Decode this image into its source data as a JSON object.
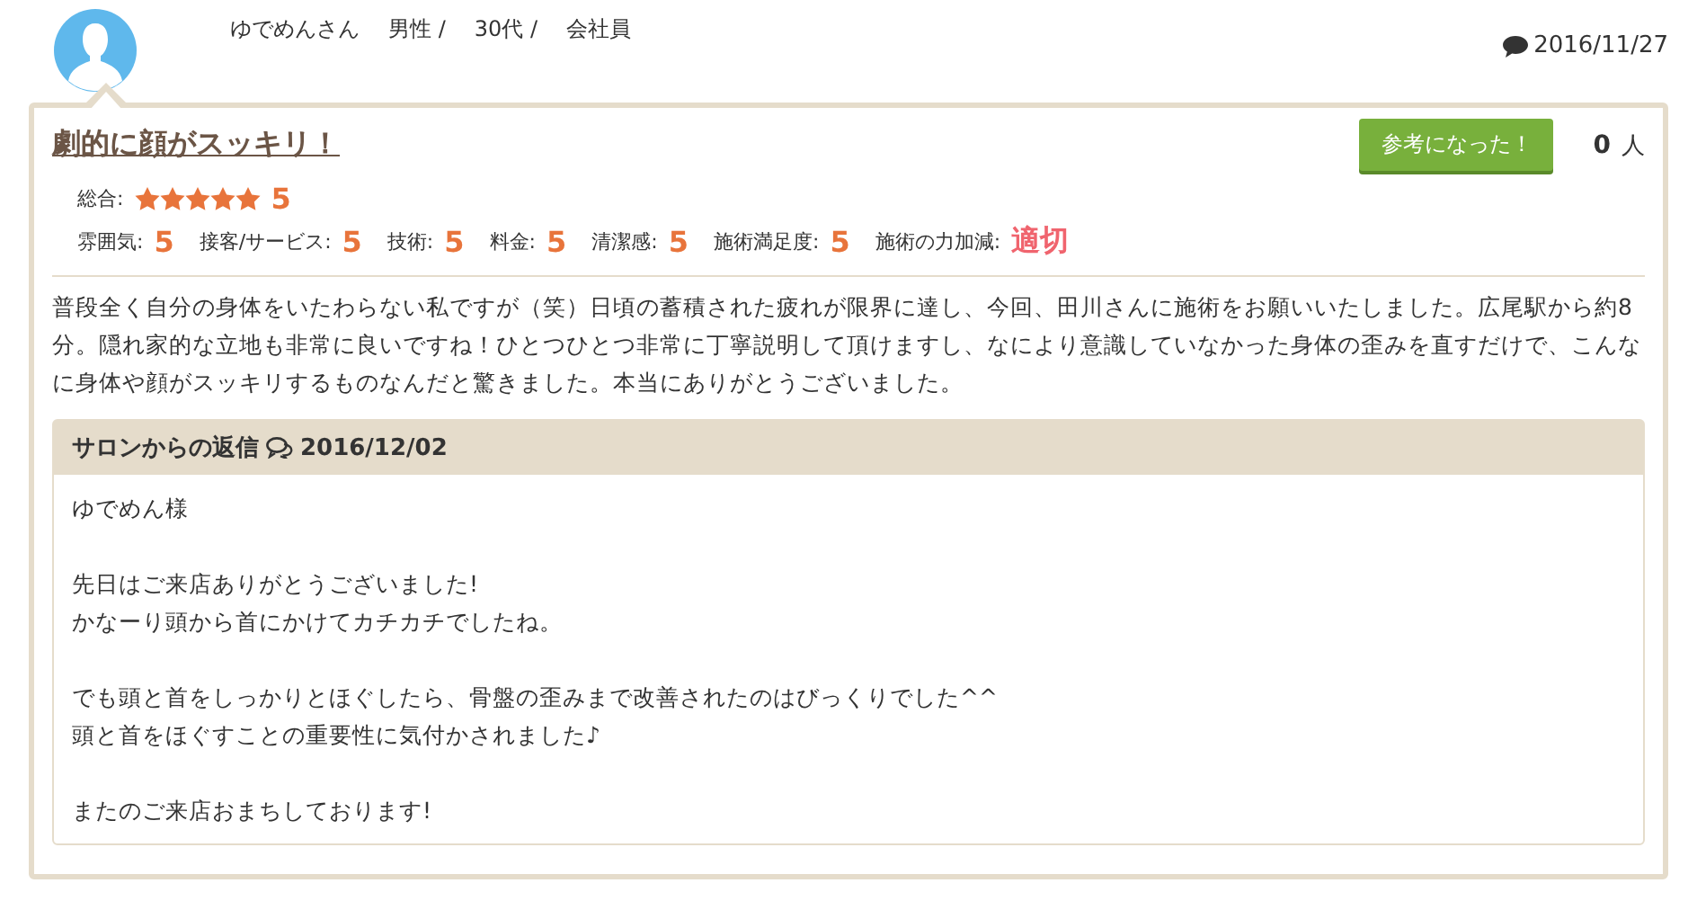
{
  "reviewer": {
    "name": "ゆでめんさん",
    "gender": "男性 /",
    "age": "30代 /",
    "occupation": "会社員"
  },
  "posted_date": "2016/11/27",
  "review": {
    "title": "劇的に顔がスッキリ！",
    "helpful_button": "参考になった！",
    "helpful_count": "0",
    "helpful_unit": "人",
    "overall": {
      "label": "総合:",
      "stars": 5,
      "score": "5"
    },
    "ratings": [
      {
        "label": "雰囲気:",
        "value": "5",
        "kind": "score"
      },
      {
        "label": "接客/サービス:",
        "value": "5",
        "kind": "score"
      },
      {
        "label": "技術:",
        "value": "5",
        "kind": "score"
      },
      {
        "label": "料金:",
        "value": "5",
        "kind": "score"
      },
      {
        "label": "清潔感:",
        "value": "5",
        "kind": "score"
      },
      {
        "label": "施術満足度:",
        "value": "5",
        "kind": "score"
      },
      {
        "label": "施術の力加減:",
        "value": "適切",
        "kind": "verdict"
      }
    ],
    "body": "普段全く自分の身体をいたわらない私ですが（笑）日頃の蓄積された疲れが限界に達し、今回、田川さんに施術をお願いいたしました。広尾駅から約8分。隠れ家的な立地も非常に良いですね！ひとつひとつ非常に丁寧説明して頂けますし、なにより意識していなかった身体の歪みを直すだけで、こんなに身体や顔がスッキリするものなんだと驚きました。本当にありがとうございました。"
  },
  "salon_reply": {
    "heading": "サロンからの返信",
    "date": "2016/12/02",
    "paragraphs": [
      [
        "ゆでめん様"
      ],
      [
        "先日はご来店ありがとうございました!",
        "かなーり頭から首にかけてカチカチでしたね。"
      ],
      [
        "でも頭と首をしっかりとほぐしたら、骨盤の歪みまで改善されたのはびっくりでした^^",
        "頭と首をほぐすことの重要性に気付かされました♪"
      ],
      [
        "またのご来店おまちしております!"
      ]
    ]
  }
}
